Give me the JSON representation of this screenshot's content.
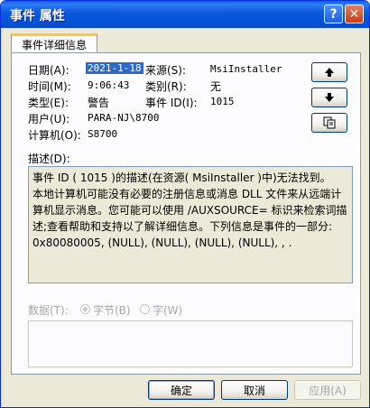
{
  "window": {
    "title": "事件 属性"
  },
  "tabs": [
    {
      "label": "事件详细信息"
    }
  ],
  "fields": {
    "date_label": "日期(A):",
    "date_value": "2021-1-18",
    "source_label": "来源(S):",
    "source_value": "MsiInstaller",
    "time_label": "时间(M):",
    "time_value": "9:06:43",
    "category_label": "类别(R):",
    "category_value": "无",
    "type_label": "类型(E):",
    "type_value": "警告",
    "event_id_label": "事件 ID(I):",
    "event_id_value": "1015",
    "user_label": "用户(U):",
    "user_value": "PARA-NJ\\8700",
    "computer_label": "计算机(O):",
    "computer_value": "S8700"
  },
  "description": {
    "label": "描述(D):",
    "lines": [
      "事件 ID ( 1015 )的描述(在资源( MsiInstaller )中)无法找到。",
      "本地计算机可能没有必要的注册信息或消息 DLL 文件来从远端计",
      "算机显示消息。您可能可以使用 /AUXSOURCE= 标识来检索词描",
      "述;查看帮助和支持以了解详细信息。下列信息是事件的一部分:",
      "0x80080005, (NULL), (NULL), (NULL), (NULL), , ."
    ]
  },
  "data_section": {
    "label": "数据(T):",
    "options": [
      {
        "label": "字节(B)",
        "selected": true
      },
      {
        "label": "字(W)",
        "selected": false
      }
    ]
  },
  "icons": {
    "help": "question-mark-icon",
    "close": "close-x-icon",
    "up": "arrow-up-icon",
    "down": "arrow-down-icon",
    "copy": "copy-icon"
  },
  "buttons": {
    "ok": "确定",
    "cancel": "取消",
    "apply": "应用(A)"
  },
  "colors": {
    "titlebar": "#0a58dc",
    "selection": "#316ac5",
    "panel_bg": "#ece9d8"
  }
}
